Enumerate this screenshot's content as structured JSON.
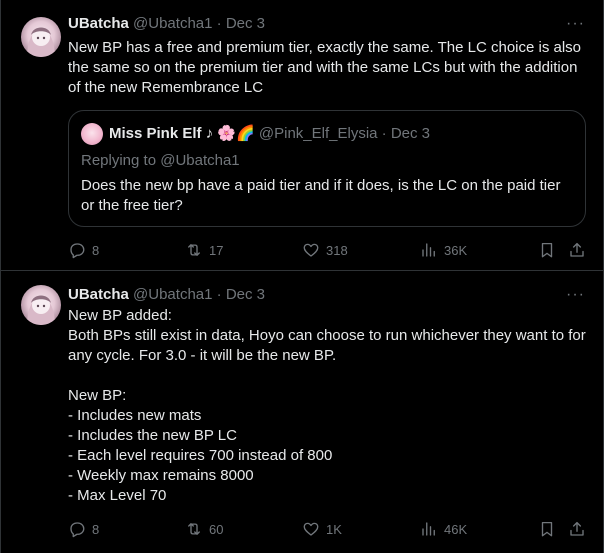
{
  "tweets": [
    {
      "name": "UBatcha",
      "handle": "@Ubatcha1",
      "sep": "·",
      "date": "Dec 3",
      "text": "New BP has a free and premium tier, exactly the same. The LC choice is also the same so on the premium tier and with the same LCs but with the addition of the new Remembrance LC",
      "quote": {
        "name": "Miss Pink Elf ♪ 🌸🌈",
        "handle": "@Pink_Elf_Elysia",
        "sep": "·",
        "date": "Dec 3",
        "replying_to": "Replying to @Ubatcha1",
        "text": "Does the new bp have a paid tier and if it does, is the LC on the paid tier or the free tier?"
      },
      "actions": {
        "replies": "8",
        "reposts": "17",
        "likes": "318",
        "views": "36K"
      }
    },
    {
      "name": "UBatcha",
      "handle": "@Ubatcha1",
      "sep": "·",
      "date": "Dec 3",
      "text": "New BP added:\nBoth BPs still exist in data, Hoyo can choose to run whichever they want to for any cycle. For 3.0 - it will be the new BP.\n\nNew BP:\n- Includes new mats\n- Includes the new BP LC\n- Each level requires 700 instead of 800\n- Weekly max remains 8000\n- Max Level 70",
      "actions": {
        "replies": "8",
        "reposts": "60",
        "likes": "1K",
        "views": "46K"
      }
    }
  ],
  "more_icon": "···",
  "icons": [
    "reply-icon",
    "repost-icon",
    "like-icon",
    "views-icon",
    "bookmark-icon",
    "share-icon",
    "more-icon"
  ]
}
